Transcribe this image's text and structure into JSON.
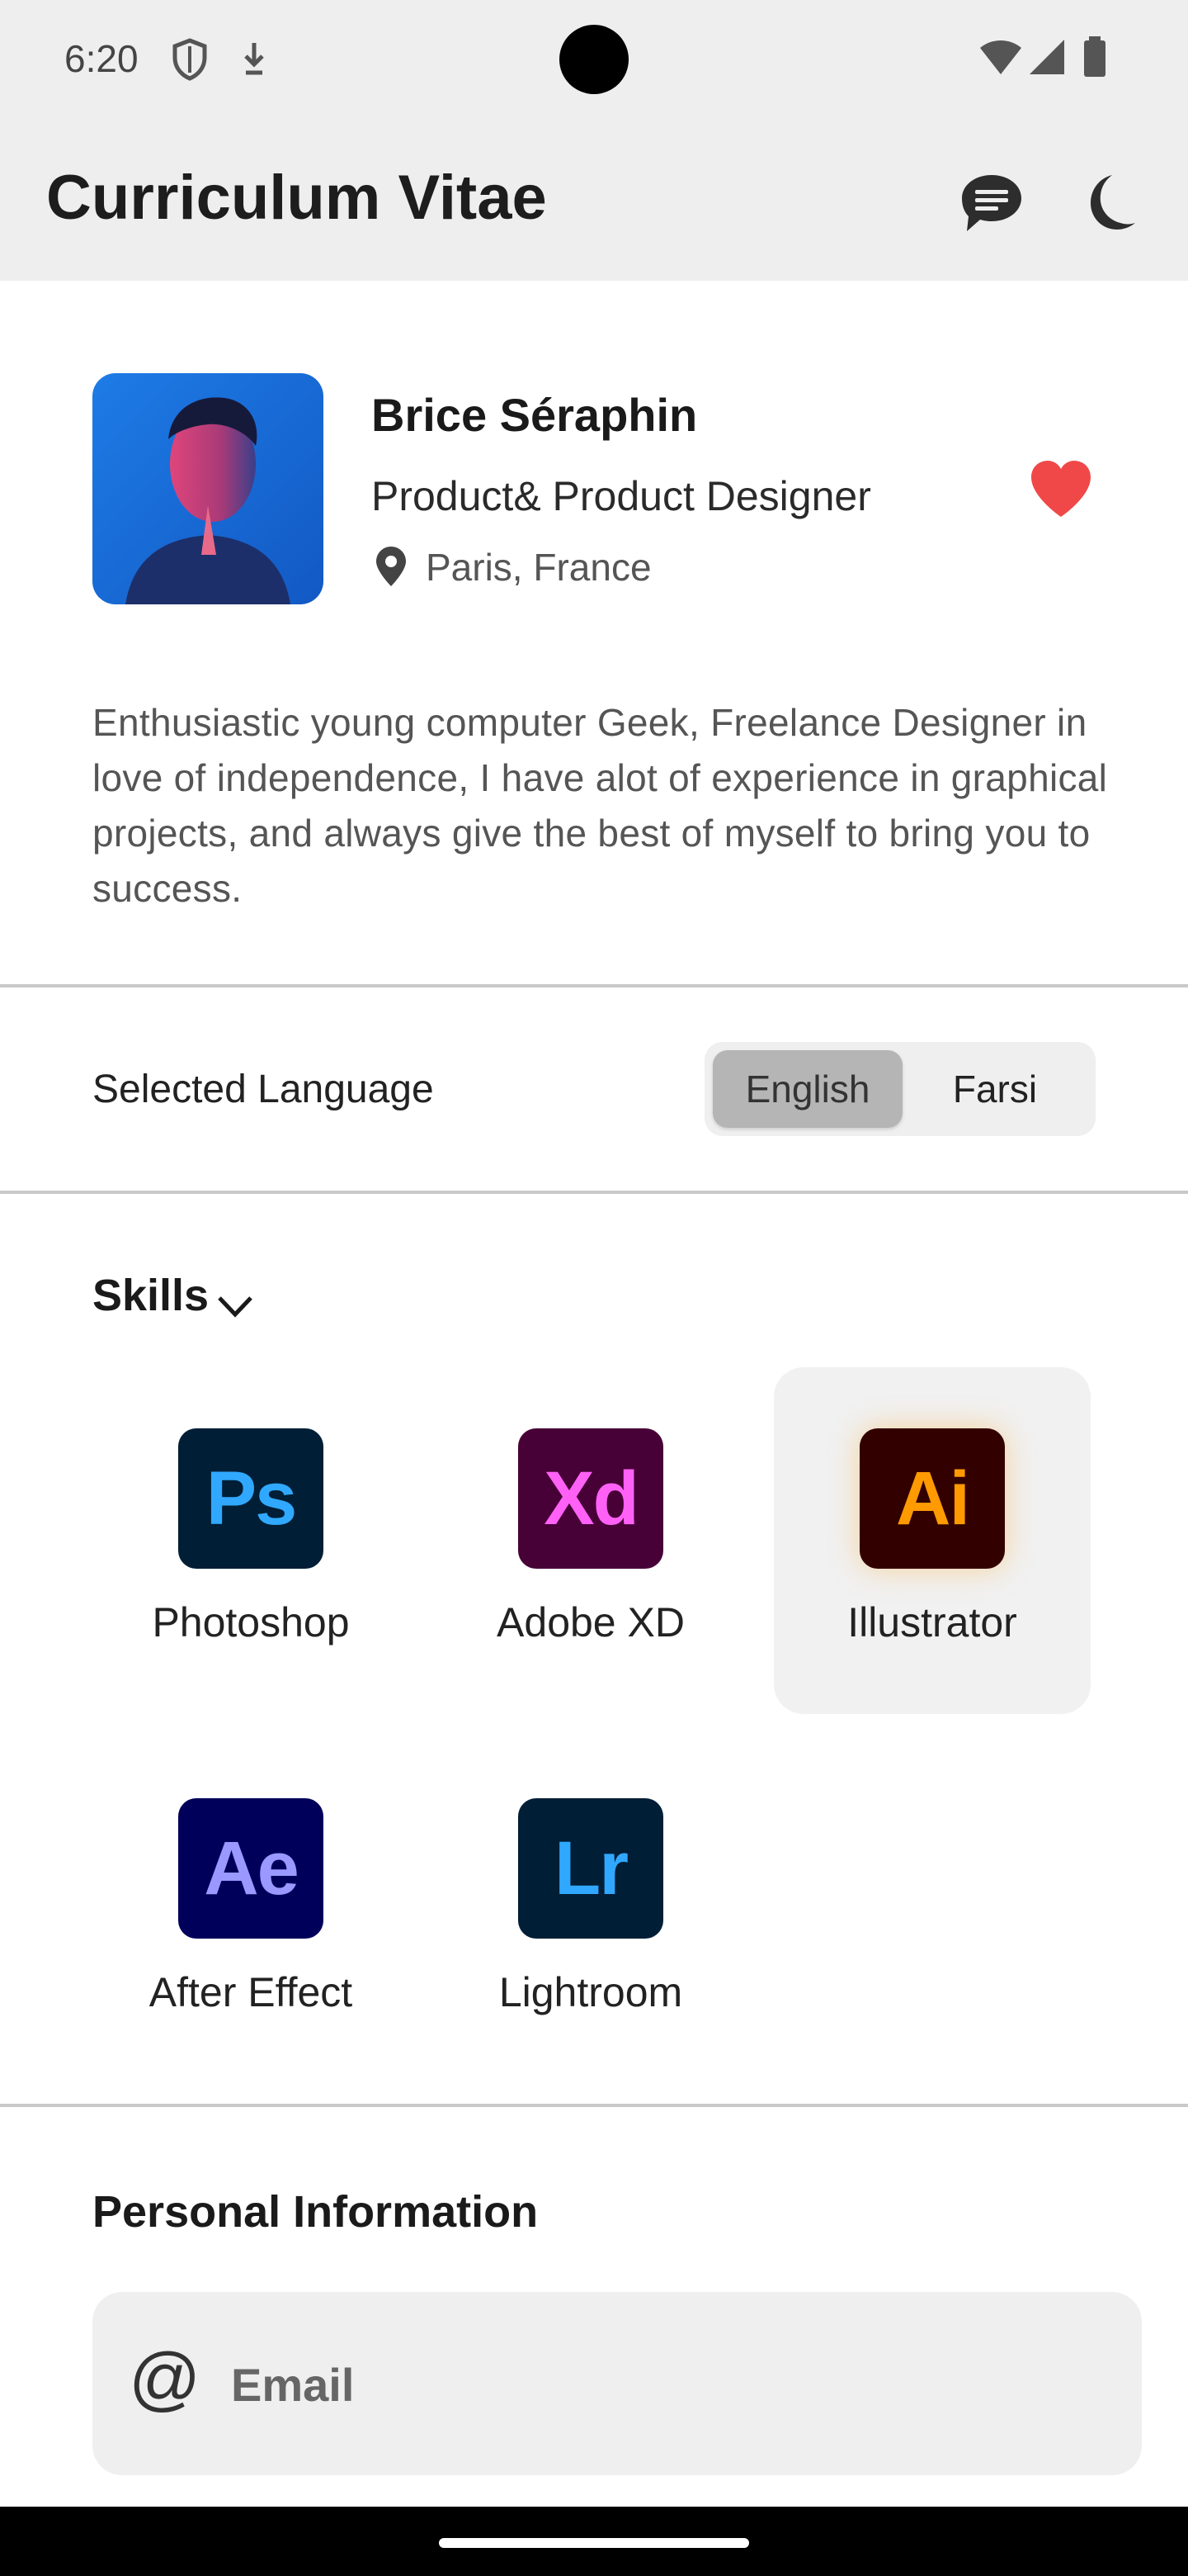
{
  "status_bar": {
    "time": "6:20"
  },
  "app_bar": {
    "title": "Curriculum Vitae",
    "icons": [
      "message-icon",
      "dark-mode-icon"
    ]
  },
  "profile": {
    "name": "Brice Séraphin",
    "role": "Product& Product Designer",
    "location": "Paris, France",
    "favorite": true,
    "bio": "Enthusiastic young computer Geek, Freelance Designer in love of independence, I have alot of experience in graphical projects, and always give the best of myself to bring you to success."
  },
  "language": {
    "label": "Selected Language",
    "options": [
      "English",
      "Farsi"
    ],
    "selected": "English"
  },
  "skills": {
    "title": "Skills",
    "items": [
      {
        "abbr": "Ps",
        "label": "Photoshop",
        "bg": "#001e36",
        "fg": "#31a8ff"
      },
      {
        "abbr": "Xd",
        "label": "Adobe XD",
        "bg": "#470137",
        "fg": "#ff61f6"
      },
      {
        "abbr": "Ai",
        "label": "Illustrator",
        "bg": "#330000",
        "fg": "#ff9a00"
      },
      {
        "abbr": "Ae",
        "label": "After Effect",
        "bg": "#00005b",
        "fg": "#9999ff"
      },
      {
        "abbr": "Lr",
        "label": "Lightroom",
        "bg": "#001e36",
        "fg": "#31a8ff"
      }
    ],
    "selected": "Illustrator"
  },
  "personal_info": {
    "title": "Personal Information",
    "email_placeholder": "Email"
  },
  "colors": {
    "heart": "#f04848",
    "app_bar_bg": "#eeeeee"
  }
}
